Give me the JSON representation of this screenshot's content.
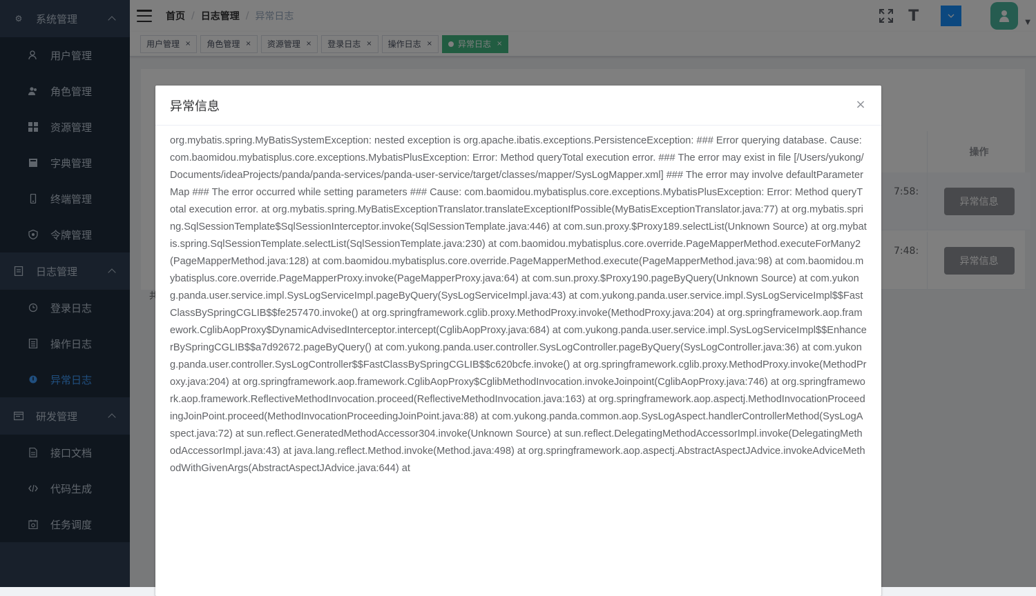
{
  "sidebar": {
    "groups": [
      {
        "label": "系统管理",
        "items": [
          {
            "label": "用户管理"
          },
          {
            "label": "角色管理"
          },
          {
            "label": "资源管理"
          },
          {
            "label": "字典管理"
          },
          {
            "label": "终端管理"
          },
          {
            "label": "令牌管理"
          }
        ]
      },
      {
        "label": "日志管理",
        "items": [
          {
            "label": "登录日志"
          },
          {
            "label": "操作日志"
          },
          {
            "label": "异常日志"
          }
        ]
      },
      {
        "label": "研发管理",
        "items": [
          {
            "label": "接口文档"
          },
          {
            "label": "代码生成"
          },
          {
            "label": "任务调度"
          }
        ]
      }
    ]
  },
  "header": {
    "breadcrumb": [
      "首页",
      "日志管理",
      "异常日志"
    ],
    "size_icon": "T",
    "caret": "▼"
  },
  "tags": [
    {
      "label": "用户管理",
      "close": "×"
    },
    {
      "label": "角色管理",
      "close": "×"
    },
    {
      "label": "资源管理",
      "close": "×"
    },
    {
      "label": "登录日志",
      "close": "×"
    },
    {
      "label": "操作日志",
      "close": "×"
    },
    {
      "label": "异常日志",
      "close": "×"
    }
  ],
  "table": {
    "op_header": "操作",
    "rows": [
      {
        "time": "7:58:",
        "button": "异常信息"
      },
      {
        "time": "7:48:",
        "button": "异常信息"
      }
    ],
    "total_fragment": "共"
  },
  "dialog": {
    "title": "异常信息",
    "close": "×",
    "content": "org.mybatis.spring.MyBatisSystemException: nested exception is org.apache.ibatis.exceptions.PersistenceException: ### Error querying database. Cause: com.baomidou.mybatisplus.core.exceptions.MybatisPlusException: Error: Method queryTotal execution error. ### The error may exist in file [/Users/yukong/Documents/ideaProjects/panda/panda-services/panda-user-service/target/classes/mapper/SysLogMapper.xml] ### The error may involve defaultParameterMap ### The error occurred while setting parameters ### Cause: com.baomidou.mybatisplus.core.exceptions.MybatisPlusException: Error: Method queryTotal execution error. at org.mybatis.spring.MyBatisExceptionTranslator.translateExceptionIfPossible(MyBatisExceptionTranslator.java:77) at org.mybatis.spring.SqlSessionTemplate$SqlSessionInterceptor.invoke(SqlSessionTemplate.java:446) at com.sun.proxy.$Proxy189.selectList(Unknown Source) at org.mybatis.spring.SqlSessionTemplate.selectList(SqlSessionTemplate.java:230) at com.baomidou.mybatisplus.core.override.PageMapperMethod.executeForMany2(PageMapperMethod.java:128) at com.baomidou.mybatisplus.core.override.PageMapperMethod.execute(PageMapperMethod.java:98) at com.baomidou.mybatisplus.core.override.PageMapperProxy.invoke(PageMapperProxy.java:64) at com.sun.proxy.$Proxy190.pageByQuery(Unknown Source) at com.yukong.panda.user.service.impl.SysLogServiceImpl.pageByQuery(SysLogServiceImpl.java:43) at com.yukong.panda.user.service.impl.SysLogServiceImpl$$FastClassBySpringCGLIB$$fe257470.invoke() at org.springframework.cglib.proxy.MethodProxy.invoke(MethodProxy.java:204) at org.springframework.aop.framework.CglibAopProxy$DynamicAdvisedInterceptor.intercept(CglibAopProxy.java:684) at com.yukong.panda.user.service.impl.SysLogServiceImpl$$EnhancerBySpringCGLIB$$a7d92672.pageByQuery() at com.yukong.panda.user.controller.SysLogController.pageByQuery(SysLogController.java:36) at com.yukong.panda.user.controller.SysLogController$$FastClassBySpringCGLIB$$c620bcfe.invoke() at org.springframework.cglib.proxy.MethodProxy.invoke(MethodProxy.java:204) at org.springframework.aop.framework.CglibAopProxy$CglibMethodInvocation.invokeJoinpoint(CglibAopProxy.java:746) at org.springframework.aop.framework.ReflectiveMethodInvocation.proceed(ReflectiveMethodInvocation.java:163) at org.springframework.aop.aspectj.MethodInvocationProceedingJoinPoint.proceed(MethodInvocationProceedingJoinPoint.java:88) at com.yukong.panda.common.aop.SysLogAspect.handlerControllerMethod(SysLogAspect.java:72) at sun.reflect.GeneratedMethodAccessor304.invoke(Unknown Source) at sun.reflect.DelegatingMethodAccessorImpl.invoke(DelegatingMethodAccessorImpl.java:43) at java.lang.reflect.Method.invoke(Method.java:498) at org.springframework.aop.aspectj.AbstractAspectJAdvice.invokeAdviceMethodWithGivenArgs(AbstractAspectJAdvice.java:644) at"
  },
  "colors": {
    "sidebar_bg": "#304156",
    "submenu_bg": "#1f2d3d",
    "active_menu": "#409eff",
    "active_tag": "#42b983"
  },
  "icons": {
    "group_system": "gear-icon",
    "group_log": "document-icon",
    "group_dev": "window-icon",
    "active_item": "info-dot-icon"
  }
}
